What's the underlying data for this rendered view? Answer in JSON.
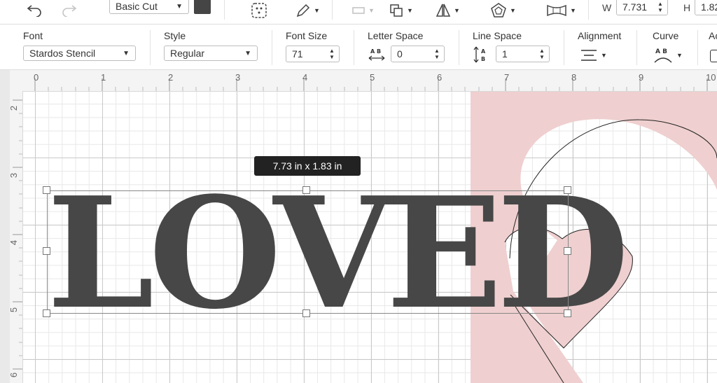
{
  "toolbar": {
    "operation": {
      "value": "Basic Cut"
    },
    "color_swatch": "#454545",
    "width": {
      "label": "W",
      "value": "7.731"
    },
    "height": {
      "label": "H",
      "value": "1.82"
    }
  },
  "text_toolbar": {
    "font": {
      "label": "Font",
      "value": "Stardos Stencil"
    },
    "style": {
      "label": "Style",
      "value": "Regular"
    },
    "font_size": {
      "label": "Font Size",
      "value": "71"
    },
    "letter_space": {
      "label": "Letter Space",
      "value": "0"
    },
    "line_space": {
      "label": "Line Space",
      "value": "1"
    },
    "alignment": {
      "label": "Alignment"
    },
    "curve": {
      "label": "Curve"
    },
    "advanced": {
      "label": "Ac"
    }
  },
  "ruler": {
    "horizontal": [
      "0",
      "1",
      "2",
      "3",
      "4",
      "5",
      "6",
      "7",
      "8",
      "9",
      "10"
    ],
    "vertical": [
      "2",
      "3",
      "4",
      "5",
      "6"
    ]
  },
  "canvas": {
    "dimension_tooltip": "7.73  in x 1.83  in",
    "text_object": "LOVED",
    "background_shape_color": "#efcfcf",
    "text_color": "#474747"
  }
}
